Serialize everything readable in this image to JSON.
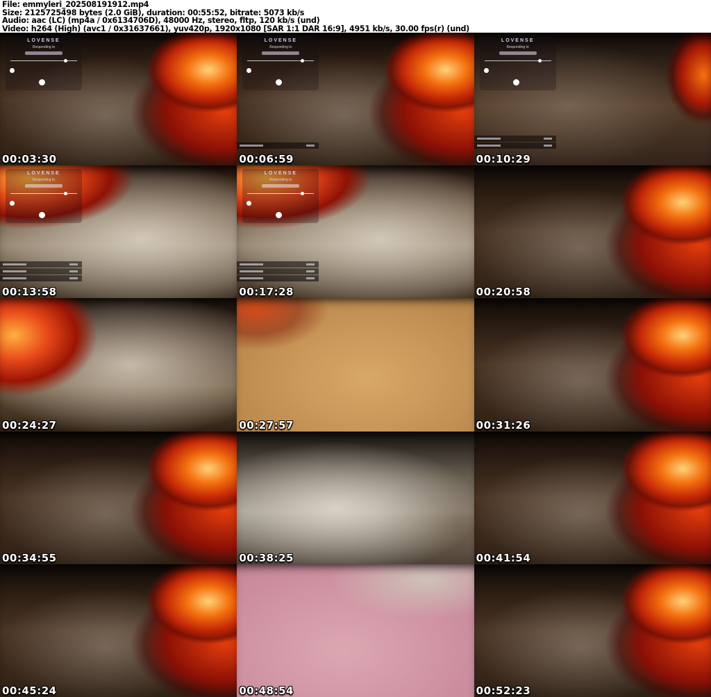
{
  "header": {
    "file": "File: emmyleri_202508191912.mp4",
    "size": "Size: 2125725498 bytes (2.0 GiB), duration: 00:55:52, bitrate: 5073 kb/s",
    "audio": "Audio: aac (LC) (mp4a / 0x6134706D), 48000 Hz, stereo, fltp, 120 kb/s (und)",
    "video": "Video: h264 (High) (avc1 / 0x31637661), yuv420p, 1920x1080 [SAR 1:1 DAR 16:9], 4951 kb/s, 30.00 fps(r) (und)"
  },
  "overlay": {
    "brand": "LOVENSE",
    "status": "Responding to"
  },
  "grid": {
    "columns": 3,
    "rows": 5,
    "thumbs": [
      {
        "time": "00:03:30",
        "scene": "fire-right",
        "overlay": true,
        "queue": false
      },
      {
        "time": "00:06:59",
        "scene": "fire-right",
        "overlay": true,
        "queue": true
      },
      {
        "time": "00:10:29",
        "scene": "fire-right-dim",
        "overlay": true,
        "queue": true
      },
      {
        "time": "00:13:58",
        "scene": "fire-topleft",
        "overlay": true,
        "queue": true
      },
      {
        "time": "00:17:28",
        "scene": "fire-topleft",
        "overlay": true,
        "queue": true
      },
      {
        "time": "00:20:58",
        "scene": "fire-right",
        "overlay": false,
        "queue": false
      },
      {
        "time": "00:24:27",
        "scene": "fire-left",
        "overlay": false,
        "queue": false
      },
      {
        "time": "00:27:57",
        "scene": "warm",
        "overlay": false,
        "queue": false
      },
      {
        "time": "00:31:26",
        "scene": "fire-right",
        "overlay": false,
        "queue": false
      },
      {
        "time": "00:34:55",
        "scene": "fire-right",
        "overlay": false,
        "queue": false
      },
      {
        "time": "00:38:25",
        "scene": "dim",
        "overlay": false,
        "queue": false
      },
      {
        "time": "00:41:54",
        "scene": "fire-right",
        "overlay": false,
        "queue": false
      },
      {
        "time": "00:45:24",
        "scene": "fire-right",
        "overlay": false,
        "queue": false
      },
      {
        "time": "00:48:54",
        "scene": "pink",
        "overlay": false,
        "queue": false
      },
      {
        "time": "00:52:23",
        "scene": "fire-right",
        "overlay": false,
        "queue": false
      }
    ]
  },
  "colors": {
    "header_bg": "#ffffff",
    "header_text": "#000000",
    "timestamp_text": "#ffffff",
    "timestamp_outline": "#000000",
    "fire_bright": "#f4710f",
    "fire_core": "#ffd27a",
    "fire_deep": "#8a1005",
    "wall_dark": "#1a120d",
    "brick_light": "#d8cfc2",
    "pink_fabric": "#dca7b2",
    "overlay_text": "#d9cdf0"
  }
}
